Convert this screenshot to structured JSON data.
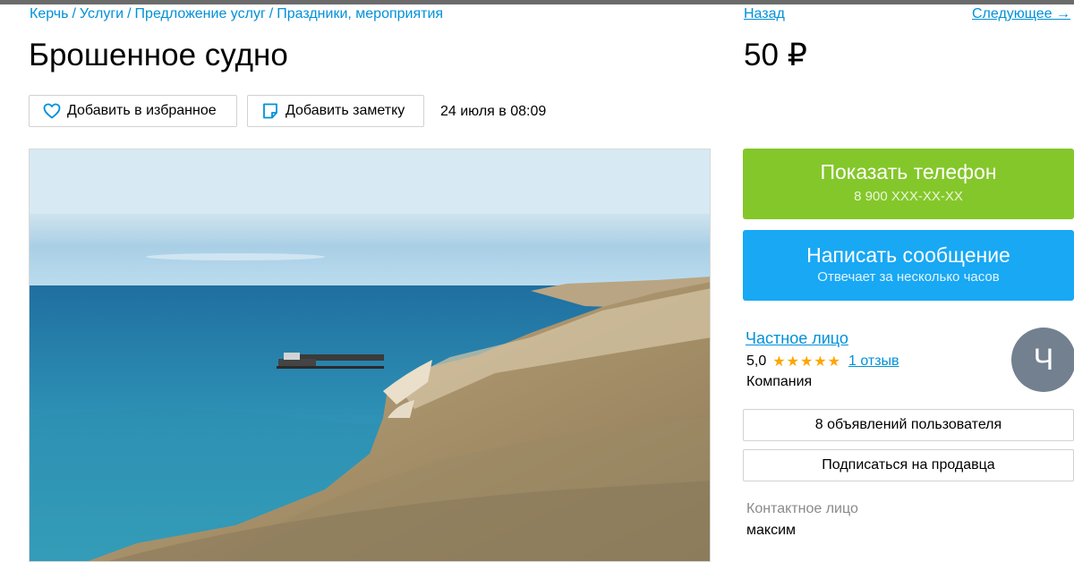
{
  "breadcrumb": {
    "items": [
      "Керчь",
      "Услуги",
      "Предложение услуг",
      "Праздники, мероприятия"
    ],
    "separator": "/"
  },
  "nav": {
    "back": "Назад",
    "next": "Следующее →"
  },
  "listing": {
    "title": "Брошенное судно",
    "price": "50 ₽",
    "date": "24 июля в 08:09"
  },
  "actions": {
    "favorite": "Добавить в избранное",
    "note": "Добавить заметку"
  },
  "contact_buttons": {
    "phone_label": "Показать телефон",
    "phone_number": "8 900 XXX-XX-XX",
    "message_label": "Написать сообщение",
    "message_sub": "Отвечает за несколько часов"
  },
  "seller": {
    "name": "Частное лицо",
    "rating": "5,0",
    "stars": "★★★★★",
    "reviews": "1 отзыв",
    "type": "Компания",
    "avatar_letter": "Ч",
    "ads_button": "8 объявлений пользователя",
    "subscribe_button": "Подписаться на продавца",
    "contact_label": "Контактное лицо",
    "contact_name": "максим"
  },
  "colors": {
    "link": "#0091d9",
    "phone_button": "#84c72a",
    "message_button": "#18a8f4",
    "stars": "#ffa500",
    "avatar": "#72808f"
  },
  "icons": {
    "favorite": "heart-icon",
    "note": "note-icon"
  }
}
